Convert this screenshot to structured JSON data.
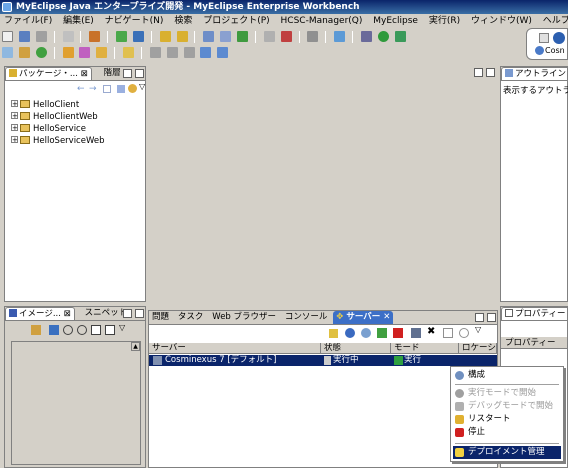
{
  "window": {
    "title": "MyEclipse Java エンタープライズ開発 - MyEclipse Enterprise Workbench"
  },
  "menu": [
    "ファイル(F)",
    "編集(E)",
    "ナビゲート(N)",
    "検索",
    "プロジェクト(P)",
    "HCSC-Manager(Q)",
    "MyEclipse",
    "実行(R)",
    "ウィンドウ(W)",
    "ヘルプ(H)"
  ],
  "perspective": {
    "label": "Cosn"
  },
  "package_explorer": {
    "tabs": [
      "パッケージ・...",
      "階層"
    ],
    "projects": [
      "HelloClient",
      "HelloClientWeb",
      "HelloService",
      "HelloServiceWeb"
    ]
  },
  "outline": {
    "tab": "アウトライン",
    "message": "表示するアウトライン"
  },
  "image_view": {
    "tabs": [
      "イメージ...",
      "スニペット"
    ]
  },
  "bottom_tabs": [
    "問題",
    "タスク",
    "Web ブラウザー",
    "コンソール",
    "サーバー"
  ],
  "properties": {
    "tab": "プロパティー",
    "column": "プロパティー"
  },
  "servers": {
    "columns": [
      "サーバー",
      "状態",
      "モード",
      "ロケーショ"
    ],
    "rows": [
      {
        "server": "Cosminexus 7 [デフォルト]",
        "state": "実行中",
        "mode": "実行"
      }
    ]
  },
  "context_menu": {
    "items": [
      {
        "label": "構成",
        "disabled": false,
        "icon": "gear-icon"
      },
      {
        "label": "実行モードで開始",
        "disabled": true,
        "icon": "run-icon"
      },
      {
        "label": "デバッグモードで開始",
        "disabled": true,
        "icon": "debug-icon"
      },
      {
        "label": "リスタート",
        "disabled": false,
        "icon": "restart-icon"
      },
      {
        "label": "停止",
        "disabled": false,
        "icon": "stop-icon"
      },
      {
        "label": "デプロイメント管理",
        "disabled": false,
        "icon": "deploy-icon"
      }
    ]
  },
  "colors": {
    "title_bar": "#0a246a",
    "selection": "#0a246a",
    "server_tab": "#3c6fc7",
    "chrome": "#d4d0c8"
  }
}
